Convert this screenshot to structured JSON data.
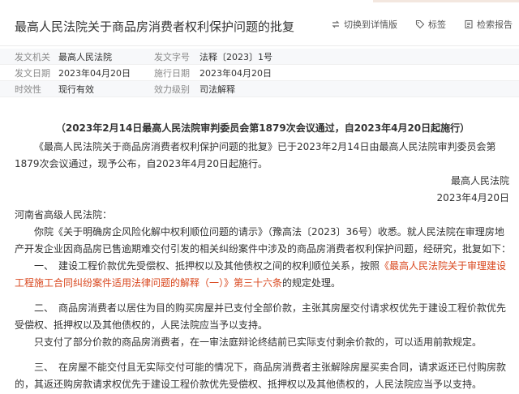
{
  "header": {
    "title": "最高人民法院关于商品房消费者权利保护问题的批复",
    "tools": [
      {
        "label": "切换到详情版",
        "icon": "switch-icon"
      },
      {
        "label": "标签",
        "icon": "tag-icon"
      },
      {
        "label": "检索报告",
        "icon": "report-icon"
      }
    ]
  },
  "meta": [
    {
      "l1": "发文机关",
      "v1": "最高人民法院",
      "l2": "发文字号",
      "v2": "法释〔2023〕1号"
    },
    {
      "l1": "发文日期",
      "v1": "2023年04月20日",
      "l2": "施行日期",
      "v2": "2023年04月20日"
    },
    {
      "l1": "时效性",
      "v1": "现行有效",
      "l2": "效力级别",
      "v2": "司法解释"
    }
  ],
  "document": {
    "subtitle": "（2023年2月14日最高人民法院审判委员会第1879次会议通过，自2023年4月20日起施行）",
    "intro": "《最高人民法院关于商品房消费者权利保护问题的批复》已于2023年2月14日由最高人民法院审判委员会第1879次会议通过，现予公布，自2023年4月20日起施行。",
    "signer": "最高人民法院",
    "sign_date": "2023年4月20日",
    "addressee": "河南省高级人民法院：",
    "para_request": "你院《关于明确房企风险化解中权利顺位问题的请示》（豫高法〔2023〕36号）收悉。就人民法院在审理房地产开发企业因商品房已售逾期难交付引发的相关纠纷案件中涉及的商品房消费者权利保护问题，经研究，批复如下：",
    "item1_pre": "一、　建设工程价款优先受偿权、抵押权以及其他债权之间的权利顺位关系，按照",
    "item1_link": "《最高人民法院关于审理建设工程施工合同纠纷案件适用法律问题的解释（一）》第三十六条",
    "item1_post": "的规定处理。",
    "item2": "二、　商品房消费者以居住为目的购买房屋并已支付全部价款，主张其房屋交付请求权优先于建设工程价款优先受偿权、抵押权以及其他债权的，人民法院应当予以支持。",
    "item2_b": "只支付了部分价款的商品房消费者，在一审法庭辩论终结前已实际支付剩余价款的，可以适用前款规定。",
    "item3": "三、　在房屋不能交付且无实际交付可能的情况下，商品房消费者主张解除房屋买卖合同，请求返还已付购房款的，其返还购房款请求权优先于建设工程价款优先受偿权、抵押权以及其他债权的，人民法院应当予以支持。"
  }
}
